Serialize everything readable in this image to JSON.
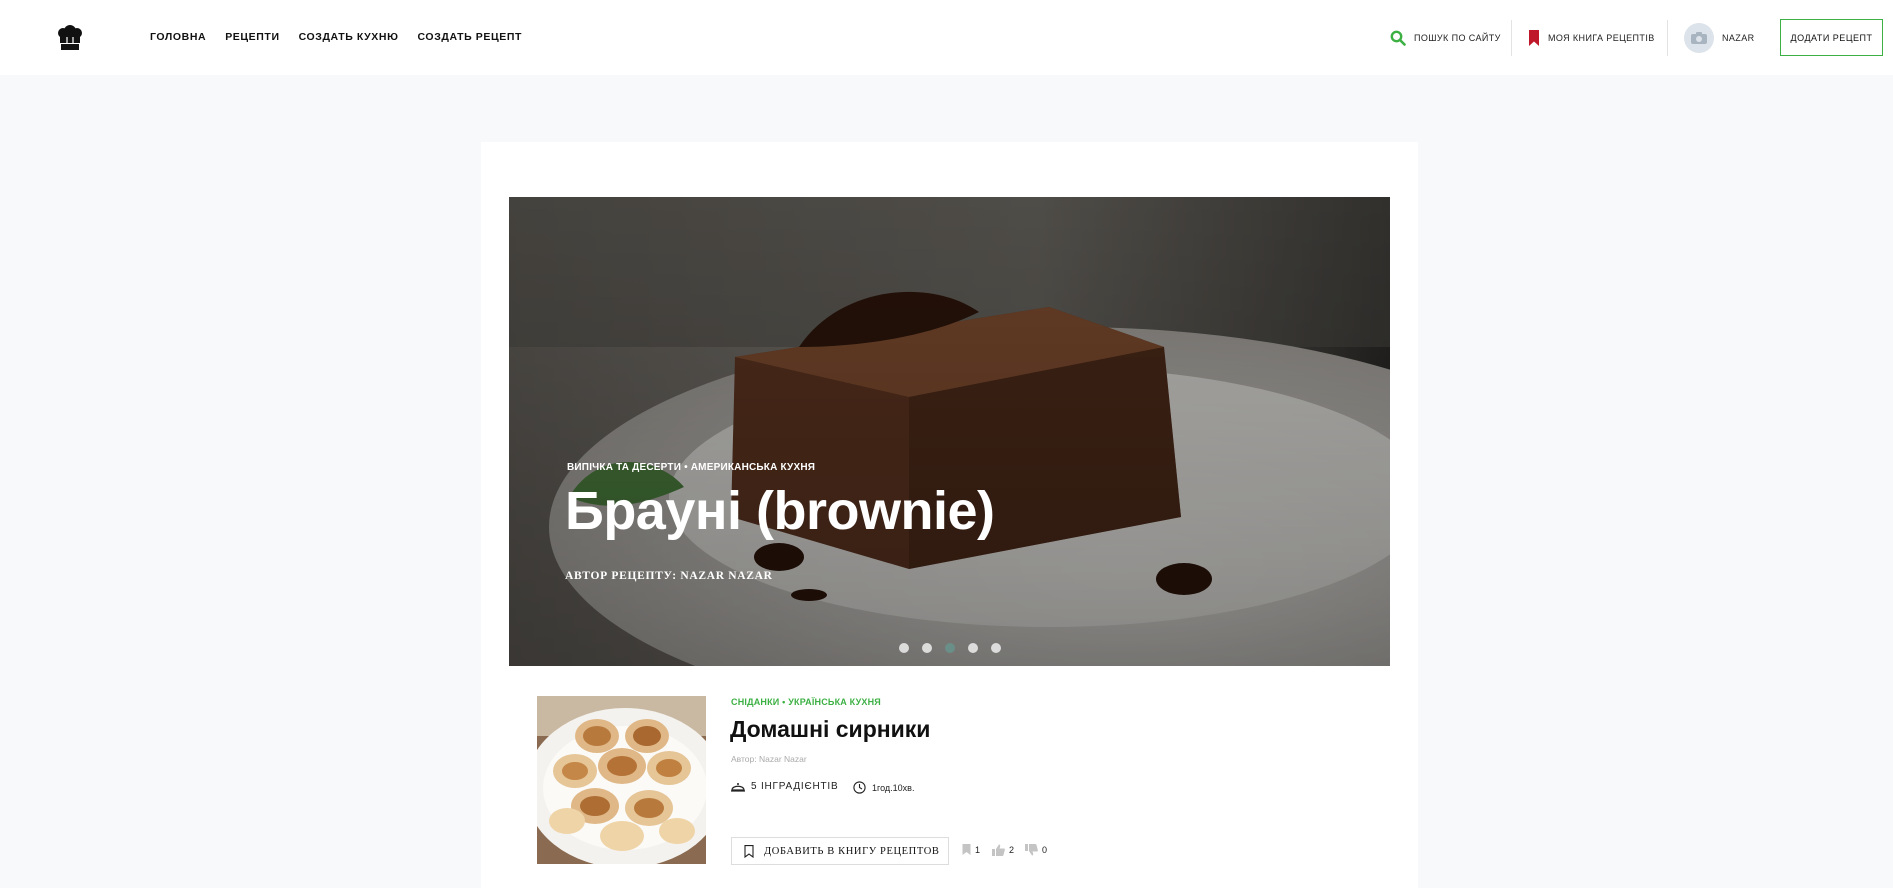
{
  "header": {
    "nav": [
      "ГОЛОВНА",
      "РЕЦЕПТИ",
      "СОЗДАТЬ КУХНЮ",
      "СОЗДАТЬ РЕЦЕПТ"
    ],
    "search_label": "ПОШУК ПО САЙТУ",
    "book_label": "МОЯ КНИГА РЕЦЕПТІВ",
    "user_name": "NAZAR",
    "add_recipe_label": "ДОДАТИ РЕЦЕПТ"
  },
  "hero": {
    "categories": "ВИПІЧКА ТА ДЕСЕРТИ • АМЕРИКАНСЬКА КУХНЯ",
    "title": "Брауні (brownie)",
    "author": "АВТОР РЕЦЕПТУ: NAZAR NAZAR",
    "slides": 5,
    "active_slide": 3
  },
  "recipe": {
    "categories": "СНІДАНКИ • УКРАЇНСЬКА КУХНЯ",
    "title": "Домашні сирники",
    "author": "Автор: Nazar Nazar",
    "ingredients": "5 ІНГРАДІЄНТІВ",
    "time": "1год.10хв.",
    "add_to_book": "ДОБАВИТЬ В КНИГУ РЕЦЕПТОВ",
    "bookmarks": "1",
    "likes": "2",
    "dislikes": "0"
  },
  "colors": {
    "accent": "#3cb043",
    "bookmark": "#c0182b",
    "page_bg": "#f8f9fa"
  },
  "icons": [
    "chef-hat-icon",
    "search-icon",
    "bookmark-icon",
    "camera-icon",
    "dish-icon",
    "clock-icon",
    "bookmark-outline-icon",
    "thumb-up-icon",
    "thumb-down-icon"
  ]
}
